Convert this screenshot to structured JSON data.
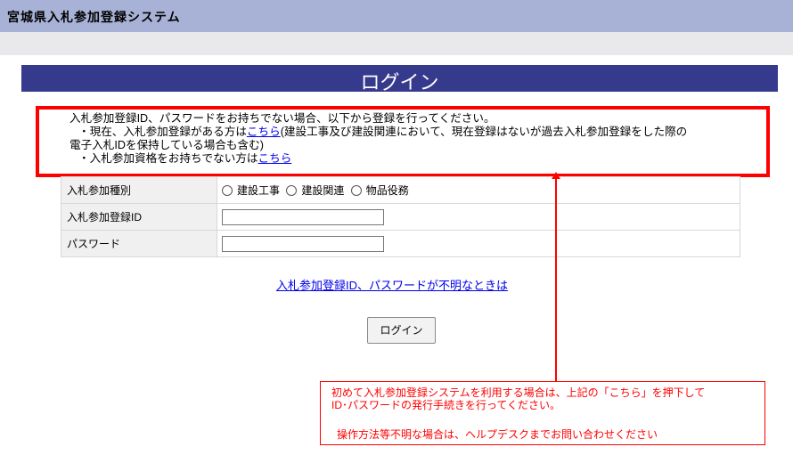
{
  "header": {
    "title": "宮城県入札参加登録システム"
  },
  "login_title": "ログイン",
  "notice": {
    "line1": "入札参加登録ID、パスワードをお持ちでない場合、以下から登録を行ってください。",
    "line2_prefix": "・現在、入札参加登録がある方は",
    "line2_link": "こちら",
    "line2_suffix": "(建設工事及び建設関連において、現在登録はないが過去入札参加登録をした際の",
    "line3": "電子入札IDを保持している場合も含む)",
    "line4_prefix": "・入札参加資格をお持ちでない方は",
    "line4_link": "こちら"
  },
  "form": {
    "type_label": "入札参加種別",
    "type_options": [
      "建設工事",
      "建設関連",
      "物品役務"
    ],
    "id_label": "入札参加登録ID",
    "id_value": "",
    "password_label": "パスワード",
    "password_value": ""
  },
  "help_link": "入札参加登録ID、パスワードが不明なときは",
  "login_button": "ログイン",
  "callout": {
    "line1": "初めて入札参加登録システムを利用する場合は、上記の「こちら」を押下して",
    "line2": "ID･パスワードの発行手続きを行ってください。",
    "line3": "操作方法等不明な場合は、ヘルプデスクまでお問い合わせください"
  },
  "colors": {
    "header_bg": "#a8b2d6",
    "login_bar": "#363a8c",
    "highlight": "#ff0000",
    "link": "#0000ee"
  }
}
